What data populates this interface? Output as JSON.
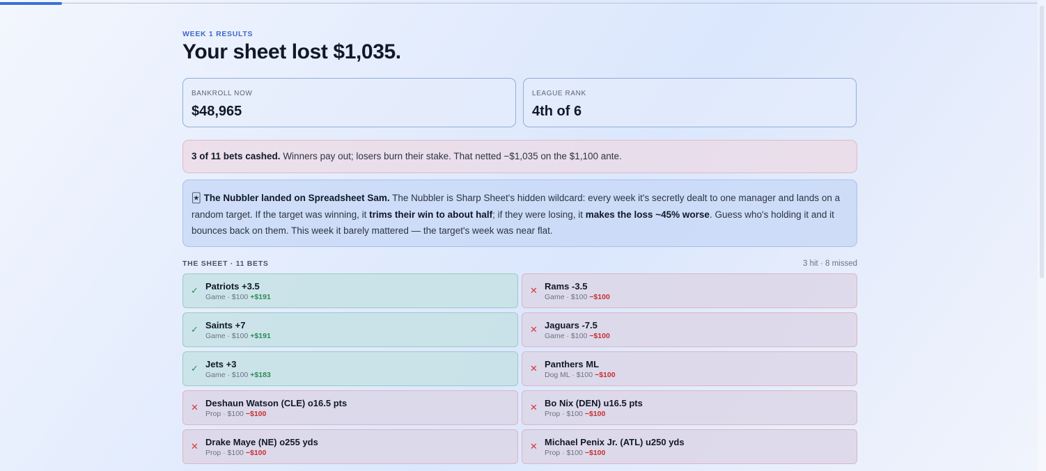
{
  "header": {
    "eyebrow": "WEEK 1 RESULTS",
    "headline": "Your sheet lost $1,035."
  },
  "stats": {
    "bankroll": {
      "label": "BANKROLL NOW",
      "value": "$48,965"
    },
    "rank": {
      "label": "LEAGUE RANK",
      "value": "4th of 6"
    }
  },
  "summary_notice": {
    "bold": "3 of 11 bets cashed.",
    "text": " Winners pay out; losers burn their stake. That netted −$1,035 on the $1,100 ante."
  },
  "nubbler_notice": {
    "icon": "🃏",
    "title": "The Nubbler landed on Spreadsheet Sam.",
    "text1": " The Nubbler is Sharp Sheet's hidden wildcard: every week it's secretly dealt to one manager and lands on a random target. If the target was winning, it ",
    "bold1": "trims their win to about half",
    "text2": "; if they were losing, it ",
    "bold2": "makes the loss ~45% worse",
    "text3": ". Guess who's holding it and it bounces back on them. This week it barely mattered — the target's week was near flat."
  },
  "sheet": {
    "label": "THE SHEET · 11 BETS",
    "summary": "3 hit · 8 missed",
    "hit_mark": "✓",
    "miss_mark": "✕",
    "bets": [
      {
        "name": "Patriots +3.5",
        "meta": "Game · $100",
        "result": "+$191",
        "status": "hit"
      },
      {
        "name": "Rams -3.5",
        "meta": "Game · $100",
        "result": "−$100",
        "status": "miss"
      },
      {
        "name": "Saints +7",
        "meta": "Game · $100",
        "result": "+$191",
        "status": "hit"
      },
      {
        "name": "Jaguars -7.5",
        "meta": "Game · $100",
        "result": "−$100",
        "status": "miss"
      },
      {
        "name": "Jets +3",
        "meta": "Game · $100",
        "result": "+$183",
        "status": "hit"
      },
      {
        "name": "Panthers ML",
        "meta": "Dog ML · $100",
        "result": "−$100",
        "status": "miss"
      },
      {
        "name": "Deshaun Watson (CLE) o16.5 pts",
        "meta": "Prop · $100",
        "result": "−$100",
        "status": "miss"
      },
      {
        "name": "Bo Nix (DEN) u16.5 pts",
        "meta": "Prop · $100",
        "result": "−$100",
        "status": "miss"
      },
      {
        "name": "Drake Maye (NE) o255 yds",
        "meta": "Prop · $100",
        "result": "−$100",
        "status": "miss"
      },
      {
        "name": "Michael Penix Jr. (ATL) u250 yds",
        "meta": "Prop · $100",
        "result": "−$100",
        "status": "miss"
      }
    ]
  },
  "colors": {
    "accent": "#3b6fd4",
    "win": "#2f8b57",
    "loss": "#c53030"
  }
}
